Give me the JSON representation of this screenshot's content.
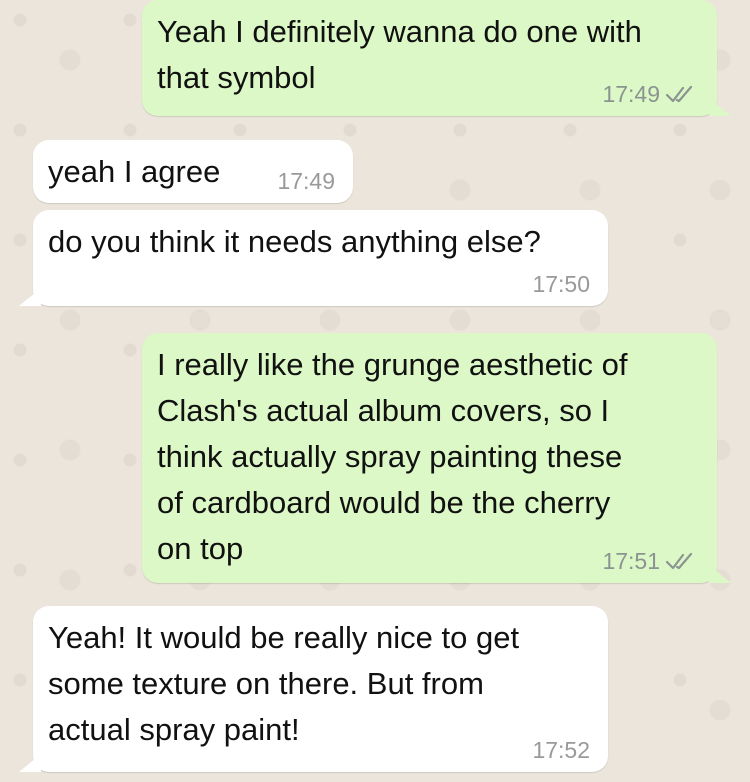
{
  "messages": [
    {
      "direction": "outgoing",
      "text": "Yeah I definitely wanna do one with\nthat symbol",
      "time": "17:49",
      "status_icon": "double-check-icon"
    },
    {
      "direction": "incoming",
      "text": "yeah I agree",
      "time": "17:49"
    },
    {
      "direction": "incoming",
      "text": "do you think it needs anything else?",
      "time": "17:50"
    },
    {
      "direction": "outgoing",
      "text": "I really like the grunge aesthetic of\nClash's actual album covers, so I\nthink actually spray painting these\nof cardboard would be the cherry\non top",
      "time": "17:51",
      "status_icon": "double-check-icon"
    },
    {
      "direction": "incoming",
      "text": "Yeah! It would be really nice to get\nsome texture on there. But from\nactual spray paint!",
      "time": "17:52"
    }
  ],
  "colors": {
    "outgoing_bubble": "#dcf8c6",
    "incoming_bubble": "#ffffff",
    "wallpaper": "#ebe5dc",
    "timestamp": "#8b9491"
  }
}
